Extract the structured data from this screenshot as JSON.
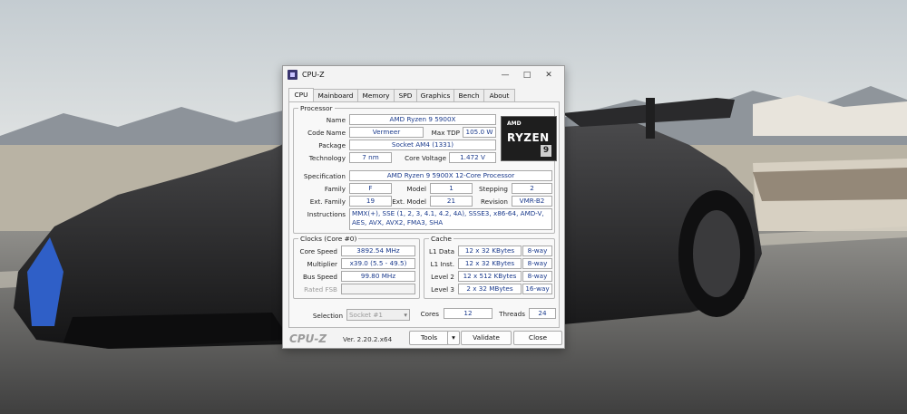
{
  "window": {
    "title": "CPU-Z",
    "minimize_icon": "minimize-icon",
    "maximize_icon": "maximize-icon",
    "close_icon": "close-icon"
  },
  "tabs": [
    {
      "label": "CPU",
      "active": true
    },
    {
      "label": "Mainboard"
    },
    {
      "label": "Memory"
    },
    {
      "label": "SPD"
    },
    {
      "label": "Graphics"
    },
    {
      "label": "Bench"
    },
    {
      "label": "About"
    }
  ],
  "processor": {
    "group_label": "Processor",
    "name_label": "Name",
    "name": "AMD Ryzen 9 5900X",
    "codename_label": "Code Name",
    "codename": "Vermeer",
    "maxtdp_label": "Max TDP",
    "maxtdp": "105.0 W",
    "package_label": "Package",
    "package": "Socket AM4 (1331)",
    "technology_label": "Technology",
    "technology": "7 nm",
    "corevoltage_label": "Core Voltage",
    "corevoltage": "1.472 V",
    "specification_label": "Specification",
    "specification": "AMD Ryzen 9 5900X 12-Core Processor",
    "family_label": "Family",
    "family": "F",
    "model_label": "Model",
    "model": "1",
    "stepping_label": "Stepping",
    "stepping": "2",
    "extfamily_label": "Ext. Family",
    "extfamily": "19",
    "extmodel_label": "Ext. Model",
    "extmodel": "21",
    "revision_label": "Revision",
    "revision": "VMR-B2",
    "instructions_label": "Instructions",
    "instructions_line1": "MMX(+), SSE (1, 2, 3, 4.1, 4.2, 4A), SSSE3, x86-64, AMD-V,",
    "instructions_line2": "AES, AVX, AVX2, FMA3, SHA",
    "logo": {
      "amd": "AMD",
      "ryzen": "RYZEN",
      "tier": "9"
    }
  },
  "clocks": {
    "group_label": "Clocks (Core #0)",
    "corespeed_label": "Core Speed",
    "corespeed": "3892.54 MHz",
    "multiplier_label": "Multiplier",
    "multiplier": "x39.0 (5.5 - 49.5)",
    "busspeed_label": "Bus Speed",
    "busspeed": "99.80 MHz",
    "ratedfsb_label": "Rated FSB",
    "ratedfsb": ""
  },
  "cache": {
    "group_label": "Cache",
    "rows": [
      {
        "label": "L1 Data",
        "size": "12 x 32 KBytes",
        "way": "8-way"
      },
      {
        "label": "L1 Inst.",
        "size": "12 x 32 KBytes",
        "way": "8-way"
      },
      {
        "label": "Level 2",
        "size": "12 x 512 KBytes",
        "way": "8-way"
      },
      {
        "label": "Level 3",
        "size": "2 x 32 MBytes",
        "way": "16-way"
      }
    ]
  },
  "selection": {
    "label": "Selection",
    "value": "Socket #1",
    "cores_label": "Cores",
    "cores": "12",
    "threads_label": "Threads",
    "threads": "24"
  },
  "footer": {
    "brand": "CPU-Z",
    "version": "Ver. 2.20.2.x64",
    "tools_label": "Tools",
    "validate_label": "Validate",
    "close_label": "Close"
  }
}
